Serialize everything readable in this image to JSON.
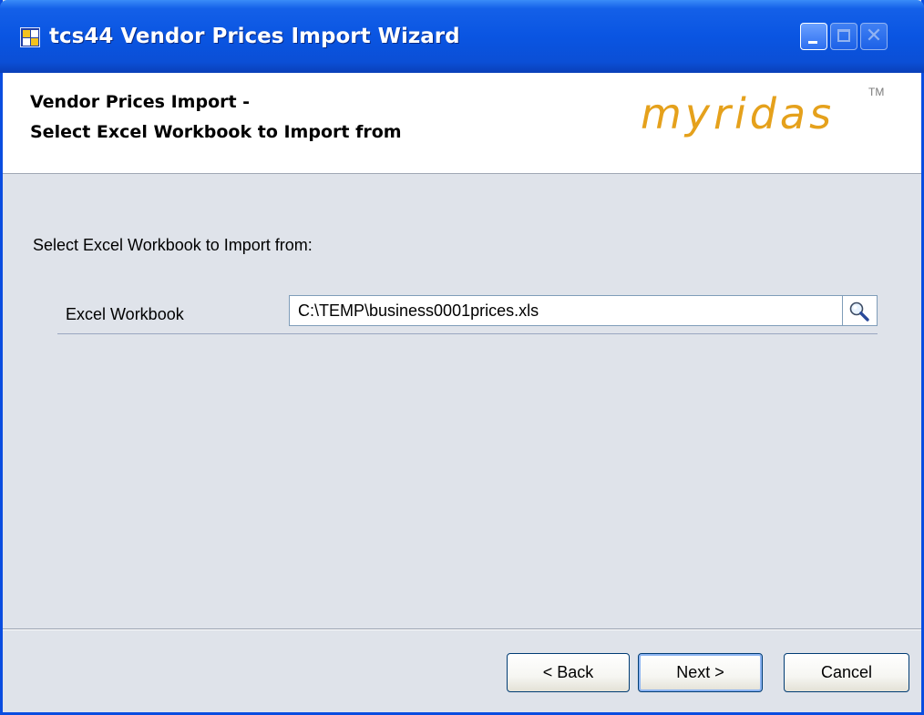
{
  "window": {
    "title": "tcs44 Vendor Prices Import Wizard"
  },
  "header": {
    "line1": "Vendor Prices Import -",
    "line2": "Select Excel Workbook to Import from",
    "logo_text": "myridas",
    "logo_tm": "TM",
    "logo_color": "#e5a11c"
  },
  "main": {
    "prompt": "Select Excel Workbook to Import from:",
    "field": {
      "label": "Excel Workbook",
      "value": "C:\\TEMP\\business0001prices.xls",
      "browse_icon": "magnifier-icon"
    }
  },
  "footer": {
    "back_label": "< Back",
    "next_label": "Next >",
    "cancel_label": "Cancel"
  },
  "colors": {
    "titlebar": "#0a55e2",
    "body": "#dfe3ea"
  }
}
